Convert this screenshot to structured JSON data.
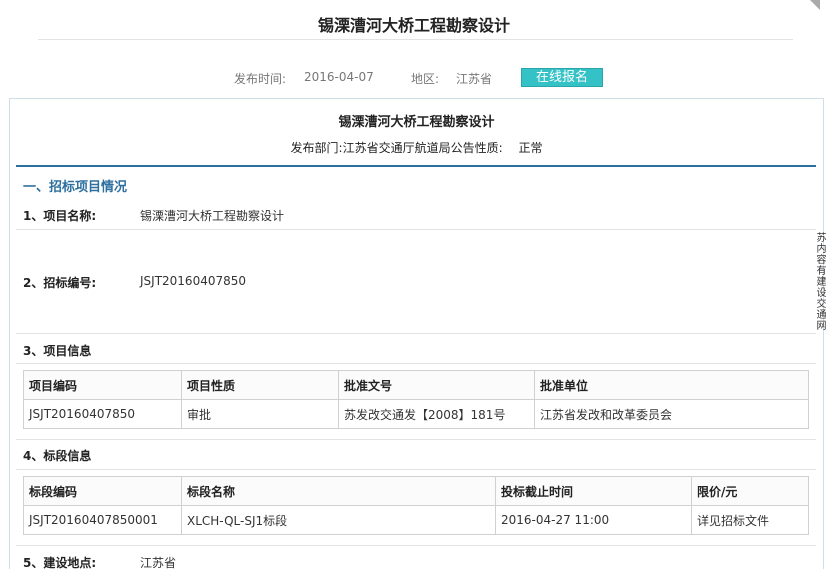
{
  "page": {
    "title": "锡溧漕河大桥工程勘察设计",
    "publish_label": "发布时间:",
    "publish_date": "2016-04-07",
    "region_label": "地区:",
    "region": "江苏省",
    "register_button": "在线报名"
  },
  "doc": {
    "title": "锡溧漕河大桥工程勘察设计",
    "dept_line": "发布部门:江苏省交通厅航道局公告性质:",
    "nature": "正常",
    "section1": "一、招标项目情况"
  },
  "rows": {
    "project_name_label": "1、项目名称:",
    "project_name": "锡溧漕河大桥工程勘察设计",
    "bid_no_label": "2、招标编号:",
    "bid_no": "JSJT20160407850",
    "project_info_label": "3、项目信息",
    "section_info_label": "4、标段信息",
    "location_label": "5、建设地点:",
    "location": "江苏省"
  },
  "project_table": {
    "headers": [
      "项目编码",
      "项目性质",
      "批准文号",
      "批准单位"
    ],
    "row": [
      "JSJT20160407850",
      "审批",
      "苏发改交通发【2008】181号",
      "江苏省发改和改革委员会"
    ]
  },
  "section_table": {
    "headers": [
      "标段编码",
      "标段名称",
      "投标截止时间",
      "限价/元"
    ],
    "row": [
      "JSJT20160407850001",
      "XLCH-QL-SJ1标段",
      "2016-04-27 11:00",
      "详见招标文件"
    ]
  },
  "side_tab": "苏内容有建设交通网"
}
